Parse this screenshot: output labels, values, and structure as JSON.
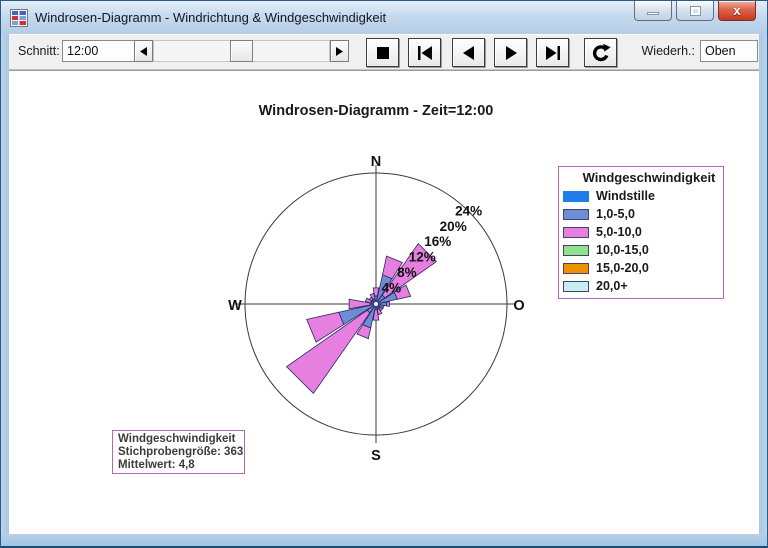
{
  "window": {
    "title": "Windrosen-Diagramm - Windrichtung & Windgeschwindigkeit",
    "controls": {
      "minimize": "minimize",
      "maximize": "maximize",
      "close": "close"
    }
  },
  "toolbar": {
    "schnitt_label": "Schnitt:",
    "schnitt_value": "12:00",
    "wiederh_label": "Wiederh.:",
    "wiederh_value": "Oben",
    "media_buttons": [
      {
        "name": "stop-button",
        "icon": "stop-icon"
      },
      {
        "name": "first-button",
        "icon": "skip-to-start-icon"
      },
      {
        "name": "previous-button",
        "icon": "step-back-icon"
      },
      {
        "name": "next-button",
        "icon": "step-forward-icon"
      },
      {
        "name": "last-button",
        "icon": "skip-to-end-icon"
      },
      {
        "name": "repeat-button",
        "icon": "repeat-icon"
      }
    ]
  },
  "chart_data": {
    "type": "windrose",
    "title": "Windrosen-Diagramm - Zeit=12:00",
    "units": "percent_of_observations",
    "direction_labels": {
      "north": "N",
      "east": "O",
      "south": "S",
      "west": "W"
    },
    "ring_ticks_pct": [
      4,
      8,
      12,
      16,
      20,
      24
    ],
    "max_ring_pct": 24,
    "directions_deg": [
      0,
      22.5,
      45,
      67.5,
      90,
      112.5,
      135,
      157.5,
      180,
      202.5,
      225,
      247.5,
      270,
      292.5,
      315,
      337.5
    ],
    "series": [
      {
        "name": "Windstille",
        "color": "#1e7de6",
        "swatch_border": "#1e7de6",
        "values": [
          0.5,
          0.5,
          0.5,
          0.5,
          0.5,
          0.5,
          0.5,
          0.5,
          0.5,
          0.5,
          0.5,
          0.5,
          0.5,
          0.5,
          0.5,
          0.5
        ]
      },
      {
        "name": "1,0-5,0",
        "color": "#6f8cd6",
        "values": [
          1.0,
          5.0,
          1.5,
          3.5,
          1.5,
          1.0,
          0.5,
          0.5,
          0.5,
          4.0,
          1.5,
          6.5,
          0.5,
          0.5,
          0.5,
          0.5
        ]
      },
      {
        "name": "5,0-10,0",
        "color": "#e67fe0",
        "values": [
          1.5,
          3.5,
          11.5,
          2.5,
          0.5,
          0,
          0.5,
          1.0,
          2.0,
          2.0,
          18.0,
          6.0,
          4.0,
          1.0,
          0.5,
          1.0
        ]
      },
      {
        "name": "10,0-15,0",
        "color": "#8fe08f",
        "values": [
          0,
          0,
          0,
          0,
          0,
          0,
          0,
          0,
          0,
          0,
          0,
          0,
          0,
          0,
          0,
          0
        ]
      },
      {
        "name": "15,0-20,0",
        "color": "#f29100",
        "values": [
          0,
          0,
          0,
          0,
          0,
          0,
          0,
          0,
          0,
          0,
          0,
          0,
          0,
          0,
          0,
          0
        ]
      },
      {
        "name": "20,0+",
        "color": "#c9eef2",
        "values": [
          0,
          0,
          0,
          0,
          0,
          0,
          0,
          0,
          0,
          0,
          0,
          0,
          0,
          0,
          0,
          0
        ]
      }
    ]
  },
  "legend": {
    "title": "Windgeschwindigkeit"
  },
  "info_box": {
    "line1": "Windgeschwindigkeit",
    "line2": "Stichprobengröße: 363",
    "line3": "Mittelwert: 4,8"
  },
  "colors": {
    "box_border": "#b36ab3",
    "petal_stroke": "#28285e",
    "titlebar": "#bcd4ea",
    "close_button": "#d44c32"
  }
}
